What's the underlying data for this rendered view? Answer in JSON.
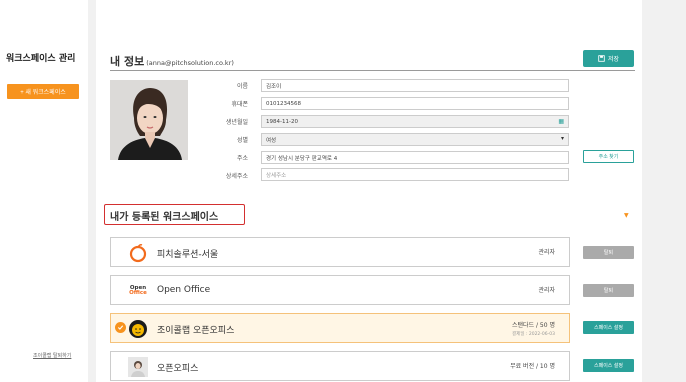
{
  "sidebar": {
    "title": "워크스페이스 관리",
    "new_button": "+ 새 워크스페이스",
    "leave_link": "조이콜랩 탈퇴하기"
  },
  "profile": {
    "title": "내 정보",
    "email": "(anna@pitchsolution.co.kr)",
    "save_button": "저장",
    "fields": {
      "name_label": "이름",
      "name_value": "김조이",
      "phone_label": "휴대폰",
      "phone_value": "0101234568",
      "birth_label": "생년월일",
      "birth_value": "1984-11-20",
      "gender_label": "성별",
      "gender_value": "여성",
      "address_label": "주소",
      "address_value": "경기 성남시 분당구 판교역로 4",
      "detail_label": "상세주소",
      "detail_placeholder": "상세주소"
    },
    "address_button": "주소 찾기"
  },
  "workspaces": {
    "title": "내가 등록된 워크스페이스",
    "items": [
      {
        "name": "피치솔루션-서울",
        "role": "관리자",
        "button": "탈퇴",
        "logo_icon": "apple-logo-icon"
      },
      {
        "name": "Open Office",
        "role": "관리자",
        "button": "탈퇴",
        "logo_icon": "open-office-logo-icon",
        "logo_top": "Open",
        "logo_bottom": "Office"
      },
      {
        "name": "조이콜랩 오픈오피스",
        "role": "스탠다드 / 50 명",
        "sub": "결제일 : 2022-06-03",
        "button": "스페이스 설정",
        "logo_icon": "joycollab-logo-icon"
      },
      {
        "name": "오픈오피스",
        "role": "무료 버전 / 10 명",
        "button": "스페이스 설정",
        "logo_icon": "person-photo-icon"
      }
    ]
  },
  "colors": {
    "accent_orange": "#f7931e",
    "accent_teal": "#2aa19a",
    "highlight_red": "#d32f2f"
  }
}
